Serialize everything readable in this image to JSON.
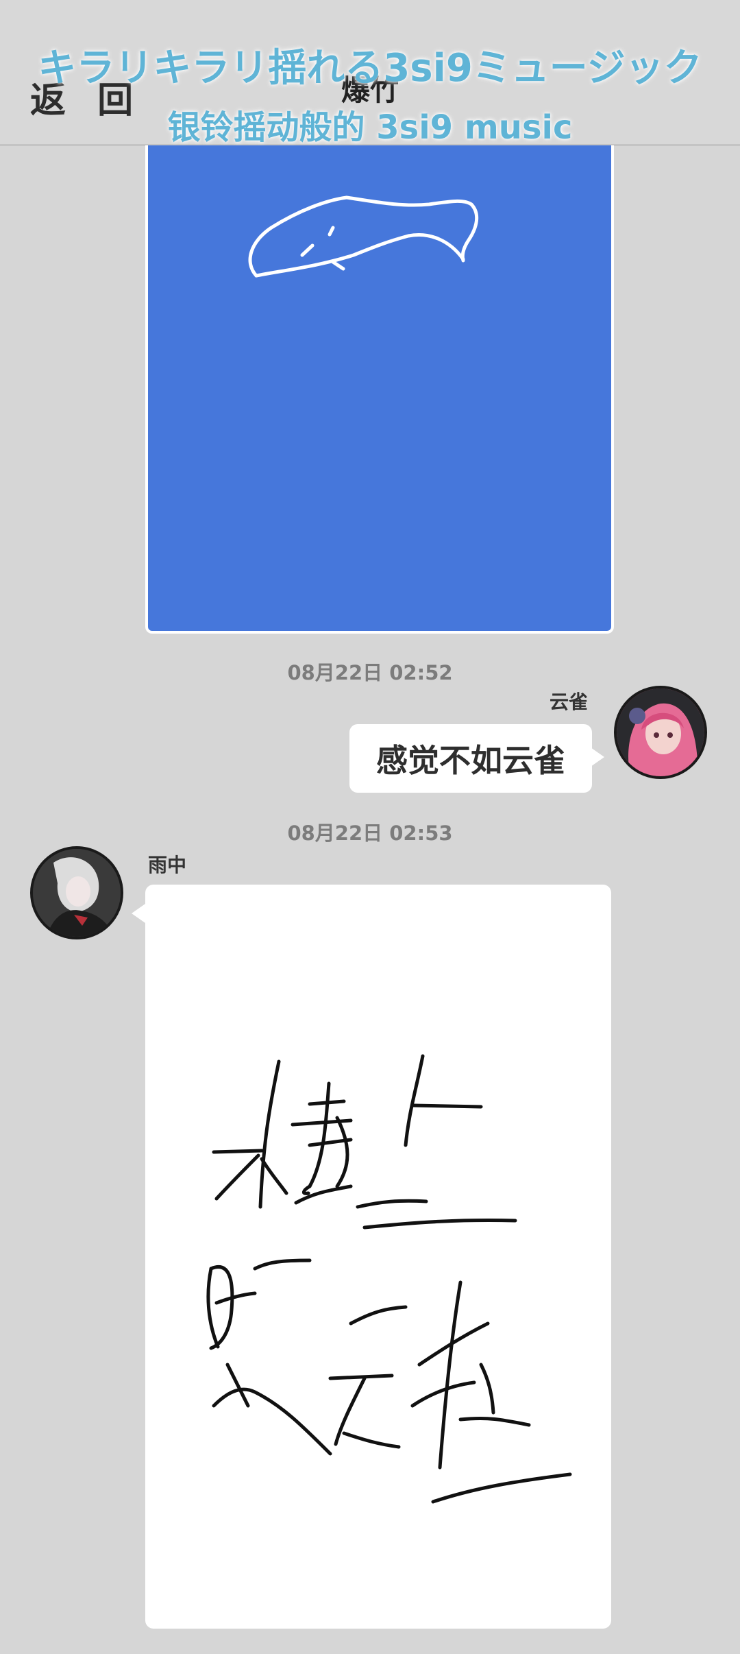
{
  "header": {
    "back_label": "返 回",
    "title": "爆竹"
  },
  "overlay": {
    "line1": "キラリキラリ揺れる3si9ミュージック",
    "line2": "银铃摇动般的 3si9 music"
  },
  "messages": [
    {
      "type": "drawing",
      "sender": "",
      "canvas_color": "#4677db",
      "stroke_color": "#ffffff"
    },
    {
      "type": "text",
      "timestamp": "08月22日  02:52",
      "sender": "云雀",
      "text": "感觉不如云雀",
      "side": "right"
    },
    {
      "type": "drawing",
      "timestamp": "08月22日  02:53",
      "sender": "雨中",
      "canvas_color": "#ffffff",
      "stroke_color": "#111111",
      "handwriting": "楼上是云雀",
      "side": "left"
    }
  ],
  "colors": {
    "background": "#d6d6d6",
    "overlay_text": "#5fb4d6",
    "timestamp": "#7c7c7c"
  }
}
